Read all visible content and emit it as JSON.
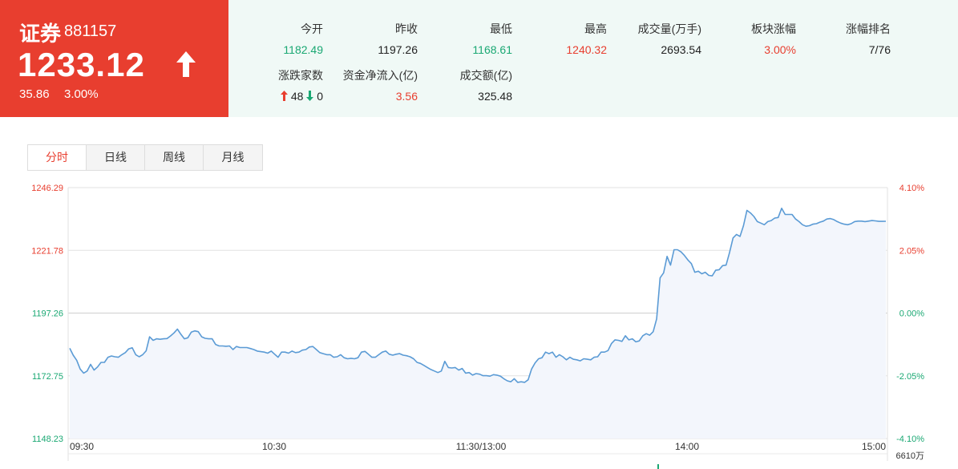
{
  "quote": {
    "name": "证券",
    "code": "881157",
    "price": "1233.12",
    "change": "35.86",
    "change_pct": "3.00%"
  },
  "stats": {
    "open_label": "今开",
    "open_value": "1182.49",
    "prev_close_label": "昨收",
    "prev_close_value": "1197.26",
    "low_label": "最低",
    "low_value": "1168.61",
    "high_label": "最高",
    "high_value": "1240.32",
    "volume_label": "成交量(万手)",
    "volume_value": "2693.54",
    "sector_change_label": "板块涨幅",
    "sector_change_value": "3.00%",
    "rank_label": "涨幅排名",
    "rank_value": "7/76",
    "advdec_label": "涨跌家数",
    "adv_count": "48",
    "dec_count": "0",
    "net_inflow_label": "资金净流入(亿)",
    "net_inflow_value": "3.56",
    "turnover_label": "成交额(亿)",
    "turnover_value": "325.48"
  },
  "tabs": [
    "分时",
    "日线",
    "周线",
    "月线"
  ],
  "active_tab": 0,
  "colors": {
    "up": "#e83e2f",
    "down": "#1aa873",
    "line": "#5b9bd5",
    "area": "#f3f6fc"
  },
  "chart_data": {
    "type": "line",
    "y_labels_left": [
      "1246.29",
      "1221.78",
      "1197.26",
      "1172.75",
      "1148.23"
    ],
    "y_labels_right": [
      "4.10%",
      "2.05%",
      "0.00%",
      "-2.05%",
      "-4.10%"
    ],
    "x_labels": [
      "09:30",
      "10:30",
      "11:30/13:00",
      "14:00",
      "15:00"
    ],
    "volume_max_label": "6610万",
    "ylim": [
      1148.23,
      1246.29
    ],
    "baseline": 1197.26,
    "values": [
      1183.5,
      1180.8,
      1178.8,
      1175.4,
      1173.8,
      1174.6,
      1177.2,
      1175.0,
      1176.2,
      1178.0,
      1178.0,
      1180.0,
      1180.5,
      1180.2,
      1180.0,
      1181.0,
      1181.8,
      1183.3,
      1183.7,
      1181.0,
      1180.2,
      1181.0,
      1182.5,
      1188.0,
      1186.6,
      1187.2,
      1187.0,
      1187.2,
      1187.3,
      1188.3,
      1189.5,
      1191.0,
      1189.0,
      1187.2,
      1187.6,
      1189.8,
      1190.3,
      1190.0,
      1188.0,
      1187.4,
      1187.2,
      1187.2,
      1185.0,
      1184.4,
      1184.4,
      1184.3,
      1184.4,
      1183.0,
      1184.2,
      1183.8,
      1183.8,
      1183.8,
      1183.4,
      1183.0,
      1182.4,
      1182.2,
      1182.0,
      1181.6,
      1182.4,
      1181.2,
      1180.0,
      1182.0,
      1182.0,
      1181.6,
      1182.4,
      1181.8,
      1182.0,
      1182.8,
      1183.0,
      1184.0,
      1184.2,
      1183.0,
      1181.8,
      1181.4,
      1181.0,
      1181.0,
      1180.0,
      1180.2,
      1181.0,
      1179.8,
      1179.4,
      1179.6,
      1179.4,
      1179.8,
      1182.0,
      1182.3,
      1181.2,
      1180.0,
      1180.0,
      1181.0,
      1182.0,
      1182.4,
      1181.2,
      1180.8,
      1181.2,
      1181.4,
      1180.8,
      1180.6,
      1180.2,
      1179.4,
      1178.0,
      1177.6,
      1176.8,
      1176.0,
      1175.2,
      1174.6,
      1174.0,
      1174.6,
      1178.4,
      1176.0,
      1175.8,
      1176.0,
      1175.0,
      1175.6,
      1173.8,
      1174.0,
      1173.0,
      1173.6,
      1173.4,
      1172.8,
      1172.8,
      1172.6,
      1173.2,
      1173.0,
      1172.6,
      1171.6,
      1170.8,
      1170.4,
      1171.6,
      1170.2,
      1170.4,
      1170.2,
      1171.2,
      1175.4,
      1177.8,
      1179.4,
      1179.8,
      1182.0,
      1181.4,
      1182.0,
      1180.0,
      1181.0,
      1180.2,
      1179.0,
      1180.0,
      1179.2,
      1179.0,
      1178.6,
      1179.4,
      1179.2,
      1179.0,
      1180.0,
      1180.2,
      1182.0,
      1182.0,
      1182.6,
      1185.4,
      1186.8,
      1186.6,
      1186.2,
      1188.4,
      1186.8,
      1187.2,
      1186.0,
      1186.4,
      1188.4,
      1189.2,
      1188.6,
      1190.0,
      1195.0,
      1211.0,
      1213.0,
      1219.4,
      1216.0,
      1222.0,
      1222.0,
      1221.2,
      1219.8,
      1218.0,
      1216.6,
      1213.2,
      1213.6,
      1212.6,
      1213.2,
      1212.0,
      1211.8,
      1214.0,
      1214.2,
      1215.8,
      1216.0,
      1221.0,
      1226.6,
      1228.0,
      1227.2,
      1231.4,
      1237.4,
      1236.4,
      1235.0,
      1233.0,
      1232.4,
      1231.8,
      1233.0,
      1233.4,
      1234.4,
      1234.6,
      1238.2,
      1235.8,
      1235.8,
      1235.8,
      1234.0,
      1233.0,
      1231.8,
      1231.2,
      1231.4,
      1232.0,
      1232.2,
      1232.8,
      1233.2,
      1234.0,
      1234.2,
      1233.8,
      1233.0,
      1232.4,
      1232.0,
      1231.8,
      1232.2,
      1233.0,
      1233.2,
      1233.2,
      1233.0,
      1233.2,
      1233.4,
      1233.3,
      1233.1,
      1233.1,
      1233.12
    ]
  }
}
